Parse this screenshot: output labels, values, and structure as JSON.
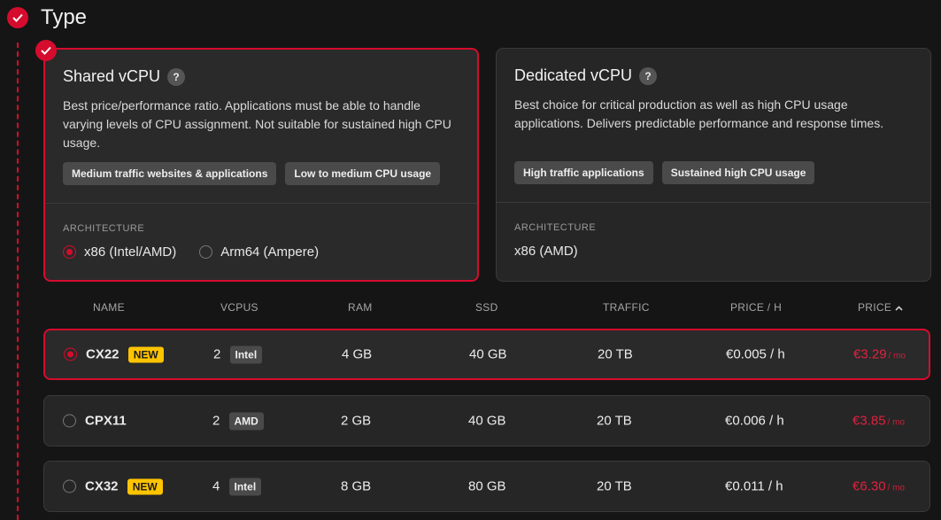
{
  "section": {
    "title": "Type"
  },
  "cards": [
    {
      "title": "Shared vCPU",
      "help": "?",
      "description": "Best price/performance ratio. Applications must be able to handle varying levels of CPU assignment. Not suitable for sustained high CPU usage.",
      "tags": [
        "Medium traffic websites & applications",
        "Low to medium CPU usage"
      ],
      "arch_label": "ARCHITECTURE",
      "arch_options": [
        "x86 (Intel/AMD)",
        "Arm64 (Ampere)"
      ],
      "selected_arch": "x86 (Intel/AMD)"
    },
    {
      "title": "Dedicated vCPU",
      "help": "?",
      "description": "Best choice for critical production as well as high CPU usage applications. Delivers predictable performance and response times.",
      "tags": [
        "High traffic applications",
        "Sustained high CPU usage"
      ],
      "arch_label": "ARCHITECTURE",
      "arch_value": "x86 (AMD)"
    }
  ],
  "table": {
    "headers": {
      "name": "NAME",
      "vcpus": "VCPUS",
      "ram": "RAM",
      "ssd": "SSD",
      "traffic": "TRAFFIC",
      "price_hour": "PRICE / H",
      "price": "PRICE"
    },
    "rows": [
      {
        "name": "CX22",
        "badge": "NEW",
        "vcpus": "2",
        "cpu": "Intel",
        "ram": "4 GB",
        "ssd": "40 GB",
        "traffic": "20 TB",
        "price_hour": "€0.005 / h",
        "price": "€3.29",
        "period": "/ mo",
        "selected": true
      },
      {
        "name": "CPX11",
        "badge": "",
        "vcpus": "2",
        "cpu": "AMD",
        "ram": "2 GB",
        "ssd": "40 GB",
        "traffic": "20 TB",
        "price_hour": "€0.006 / h",
        "price": "€3.85",
        "period": "/ mo",
        "selected": false
      },
      {
        "name": "CX32",
        "badge": "NEW",
        "vcpus": "4",
        "cpu": "Intel",
        "ram": "8 GB",
        "ssd": "80 GB",
        "traffic": "20 TB",
        "price_hour": "€0.011 / h",
        "price": "€6.30",
        "period": "/ mo",
        "selected": false
      }
    ]
  },
  "colors": {
    "accent": "#d50c2d",
    "badge_new": "#ffc400",
    "background": "#151515"
  }
}
